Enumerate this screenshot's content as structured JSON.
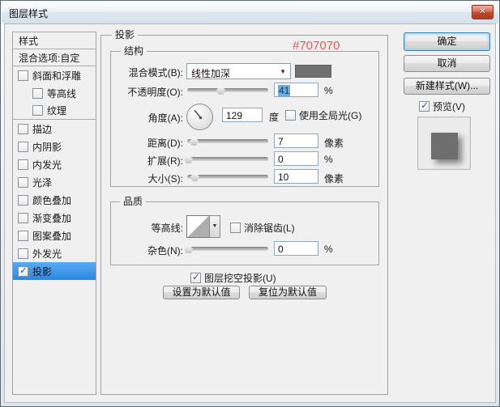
{
  "window": {
    "title": "图层样式"
  },
  "icons": {
    "close": "✕",
    "check": "✓",
    "dropdown": "▼"
  },
  "colors": {
    "accent_red": "#F75454",
    "selection_blue": "#3D9BF5",
    "swatch_gray": "#707070"
  },
  "sidebar": {
    "items": [
      {
        "key": "styles",
        "label": "样式",
        "type": "header",
        "sep": true
      },
      {
        "key": "blending-options",
        "label": "混合选项:自定",
        "type": "header",
        "sep": true
      },
      {
        "key": "bevel-emboss",
        "label": "斜面和浮雕",
        "type": "check",
        "checked": false
      },
      {
        "key": "contour",
        "label": "等高线",
        "type": "check",
        "checked": false,
        "indent": true
      },
      {
        "key": "texture",
        "label": "纹理",
        "type": "check",
        "checked": false,
        "indent": true,
        "sep": true
      },
      {
        "key": "stroke",
        "label": "描边",
        "type": "check",
        "checked": false
      },
      {
        "key": "inner-shadow",
        "label": "内阴影",
        "type": "check",
        "checked": false
      },
      {
        "key": "inner-glow",
        "label": "内发光",
        "type": "check",
        "checked": false
      },
      {
        "key": "satin",
        "label": "光泽",
        "type": "check",
        "checked": false
      },
      {
        "key": "color-overlay",
        "label": "颜色叠加",
        "type": "check",
        "checked": false
      },
      {
        "key": "gradient-overlay",
        "label": "渐变叠加",
        "type": "check",
        "checked": false
      },
      {
        "key": "pattern-overlay",
        "label": "图案叠加",
        "type": "check",
        "checked": false
      },
      {
        "key": "outer-glow",
        "label": "外发光",
        "type": "check",
        "checked": false
      },
      {
        "key": "drop-shadow",
        "label": "投影",
        "type": "check",
        "checked": true,
        "selected": true
      }
    ]
  },
  "panel": {
    "title": "投影",
    "color_note": "#707070",
    "structure": {
      "title": "结构",
      "blend_mode": {
        "label": "混合模式(B):",
        "value": "线性加深",
        "swatch": "#707070"
      },
      "opacity": {
        "label": "不透明度(O):",
        "value": "41",
        "unit": "%",
        "thumb_pct": 41
      },
      "angle": {
        "label": "角度(A):",
        "value": "129",
        "unit": "度",
        "degrees": 129
      },
      "global_light": {
        "label": "使用全局光(G)",
        "checked": false
      },
      "distance": {
        "label": "距离(D):",
        "value": "7",
        "unit": "像素",
        "thumb_pct": 8
      },
      "spread": {
        "label": "扩展(R):",
        "value": "0",
        "unit": "%",
        "thumb_pct": 1
      },
      "size": {
        "label": "大小(S):",
        "value": "10",
        "unit": "像素",
        "thumb_pct": 9
      }
    },
    "quality": {
      "title": "品质",
      "contour_label": "等高线:",
      "anti_alias": {
        "label": "消除锯齿(L)",
        "checked": false
      },
      "noise": {
        "label": "杂色(N):",
        "value": "0",
        "unit": "%",
        "thumb_pct": 1
      }
    },
    "knockout": {
      "label": "图层挖空投影(U)",
      "checked": true
    },
    "footer_buttons": {
      "make_default": "设置为默认值",
      "reset_default": "复位为默认值"
    }
  },
  "actions": {
    "ok": "确定",
    "cancel": "取消",
    "new_style": "新建样式(W)...",
    "preview": {
      "label": "预览(V)",
      "checked": true
    }
  }
}
